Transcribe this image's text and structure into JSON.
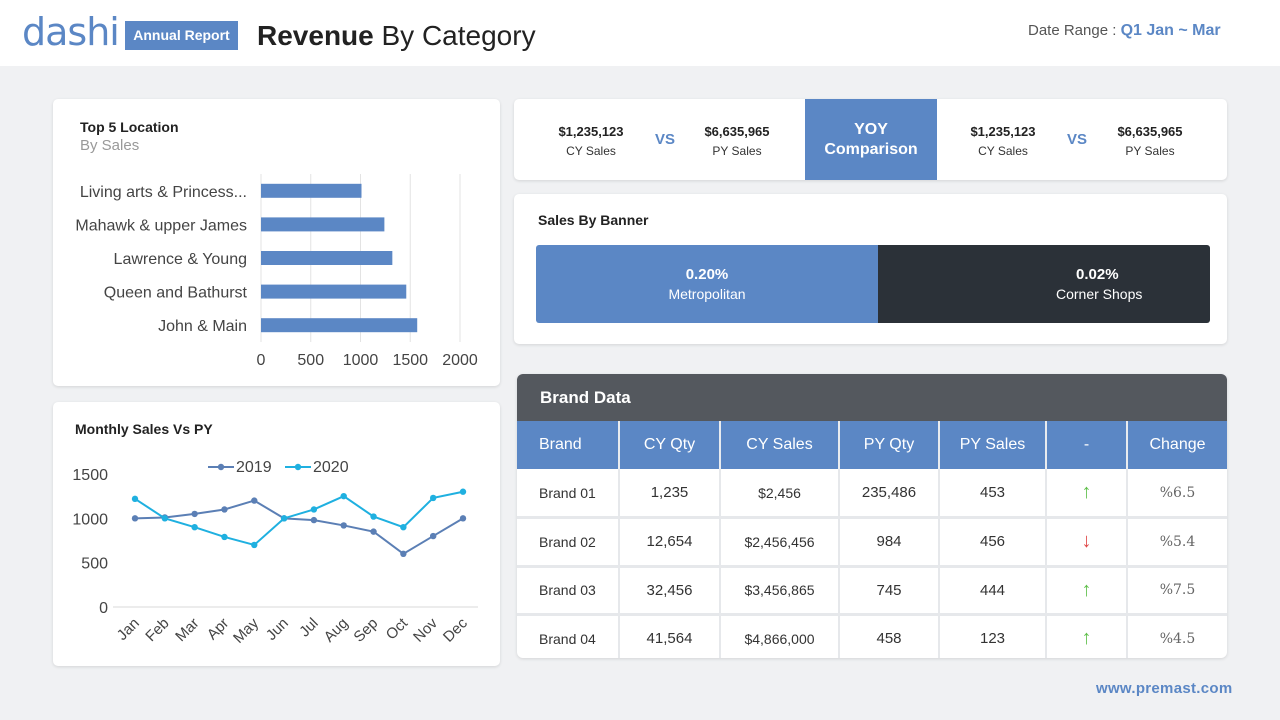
{
  "header": {
    "logo_d": "d",
    "logo_rest": "ashi",
    "badge": "Annual Report",
    "title_bold": "Revenue",
    "title_rest": " By Category",
    "date_label": "Date Range : ",
    "date_value": "Q1 Jan ~ Mar"
  },
  "top5": {
    "title": "Top 5 Location",
    "subtitle": "By Sales"
  },
  "monthly": {
    "title": "Monthly Sales Vs PY"
  },
  "yoy": {
    "left": {
      "cy_value": "$1,235,123",
      "cy_label": "CY Sales",
      "py_value": "$6,635,965",
      "py_label": "PY Sales"
    },
    "vs": "VS",
    "center_line1": "YOY",
    "center_line2": "Comparison",
    "right": {
      "cy_value": "$1,235,123",
      "cy_label": "CY Sales",
      "py_value": "$6,635,965",
      "py_label": "PY Sales"
    }
  },
  "banner": {
    "title": "Sales By Banner",
    "segments": [
      {
        "pct": "0.20%",
        "name": "Metropolitan",
        "color": "#5b87c5"
      },
      {
        "pct": "0.02%",
        "name": "Corner Shops",
        "color": "#2b3138"
      }
    ]
  },
  "brand": {
    "title": "Brand Data",
    "columns": [
      "Brand",
      "CY Qty",
      "CY Sales",
      "PY Qty",
      "PY Sales",
      "-",
      "Change"
    ],
    "rows": [
      {
        "brand": "Brand 01",
        "cy_qty": "1,235",
        "cy_sales": "$2,456",
        "py_qty": "235,486",
        "py_sales": "453",
        "trend": "up",
        "change": "%6.5"
      },
      {
        "brand": "Brand 02",
        "cy_qty": "12,654",
        "cy_sales": "$2,456,456",
        "py_qty": "984",
        "py_sales": "456",
        "trend": "down",
        "change": "%5.4"
      },
      {
        "brand": "Brand 03",
        "cy_qty": "32,456",
        "cy_sales": "$3,456,865",
        "py_qty": "745",
        "py_sales": "444",
        "trend": "up",
        "change": "%7.5"
      },
      {
        "brand": "Brand 04",
        "cy_qty": "41,564",
        "cy_sales": "$4,866,000",
        "py_qty": "458",
        "py_sales": "123",
        "trend": "up",
        "change": "%4.5"
      }
    ],
    "colors": {
      "up": "#5fbf4a",
      "down": "#e04848"
    }
  },
  "footer": {
    "url": "www.premast.com"
  },
  "chart_data": [
    {
      "type": "bar",
      "orientation": "horizontal",
      "categories": [
        "Living arts & Princess...",
        "Mahawk & upper James",
        "Lawrence & Young",
        "Queen and Bathurst",
        "John & Main"
      ],
      "values": [
        1010,
        1240,
        1320,
        1460,
        1570
      ],
      "xlim": [
        0,
        2000
      ],
      "xticks": [
        "0",
        "500",
        "1000",
        "1500",
        "2000"
      ],
      "grid": true,
      "color": "#5b87c5"
    },
    {
      "type": "line",
      "categories": [
        "Jan",
        "Feb",
        "Mar",
        "Apr",
        "May",
        "Jun",
        "Jul",
        "Aug",
        "Sep",
        "Oct",
        "Nov",
        "Dec"
      ],
      "series": [
        {
          "name": "2019",
          "color": "#5b7fb5",
          "values": [
            1000,
            1010,
            1050,
            1100,
            1200,
            1000,
            980,
            920,
            850,
            600,
            800,
            1000
          ]
        },
        {
          "name": "2020",
          "color": "#1fb0e0",
          "values": [
            1220,
            1000,
            900,
            790,
            700,
            1000,
            1100,
            1250,
            1020,
            900,
            1230,
            1300
          ]
        }
      ],
      "ylim": [
        0,
        1500
      ],
      "yticks": [
        "0",
        "500",
        "1000",
        "1500"
      ],
      "legend": "top"
    }
  ]
}
